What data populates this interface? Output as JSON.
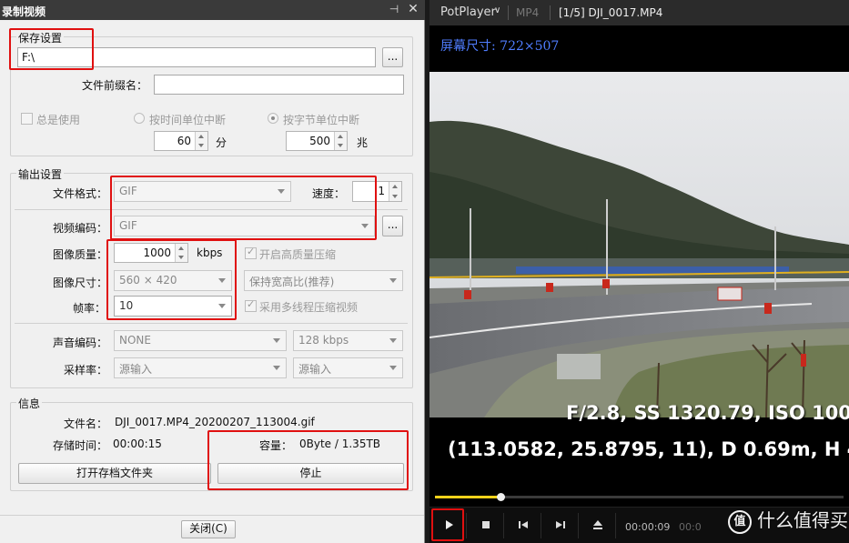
{
  "dialog": {
    "title": "录制视频",
    "save": {
      "group_label": "保存设置",
      "path": "F:\\",
      "browse_label": "...",
      "prefix_label": "文件前缀名：",
      "prefix_value": "",
      "always_use_label": "总是使用",
      "by_time_label": "按时间单位中断",
      "by_bytes_label": "按字节单位中断",
      "time_value": "60",
      "time_unit": "分",
      "bytes_value": "500",
      "bytes_unit": "兆"
    },
    "output": {
      "group_label": "输出设置",
      "format_label": "文件格式：",
      "format_value": "GIF",
      "speed_label": "速度：",
      "speed_value": "1",
      "video_codec_label": "视频编码：",
      "video_codec_value": "GIF",
      "codec_btn_label": "...",
      "quality_label": "图像质量：",
      "quality_value": "1000",
      "quality_unit": "kbps",
      "hq_compress_label": "开启高质量压缩",
      "size_label": "图像尺寸：",
      "size_value": "560 × 420",
      "aspect_value": "保持宽高比(推荐)",
      "fps_label": "帧率：",
      "fps_value": "10",
      "multithread_label": "采用多线程压缩视频",
      "audio_codec_label": "声音编码：",
      "audio_codec_value": "NONE",
      "audio_bitrate_value": "128 kbps",
      "samplerate_label": "采样率：",
      "samplerate_value": "源输入",
      "samplerate_value2": "源输入"
    },
    "info": {
      "group_label": "信息",
      "filename_label": "文件名：",
      "filename_value": "DJI_0017.MP4_20200207_113004.gif",
      "storage_time_label": "存储时间：",
      "storage_time_value": "00:00:15",
      "capacity_label": "容量：",
      "capacity_value": "0Byte / 1.35TB",
      "open_folder_label": "打开存档文件夹",
      "stop_label": "停止"
    },
    "close_label": "关闭(C)"
  },
  "player": {
    "app_name": "PotPlayer",
    "format": "MP4",
    "file_title": "[1/5] DJI_0017.MP4",
    "screen_size": "屏幕尺寸: 722×507",
    "osd_line1": "F/2.8, SS 1320.79, ISO 100,",
    "osd_line2": "(113.0582, 25.8795, 11), D 0.69m, H 4.",
    "time_current": "00:00:09",
    "time_total": "00:0",
    "progress_fraction": 0.16,
    "watermark": "什么值得买",
    "watermark_logo": "值",
    "controls": [
      "play-icon",
      "stop-icon",
      "prev-icon",
      "next-icon",
      "eject-icon"
    ]
  },
  "colors": {
    "highlight": "#e01010",
    "seek_fill": "#f4d21a",
    "screen_size_text": "#4f7dff"
  }
}
